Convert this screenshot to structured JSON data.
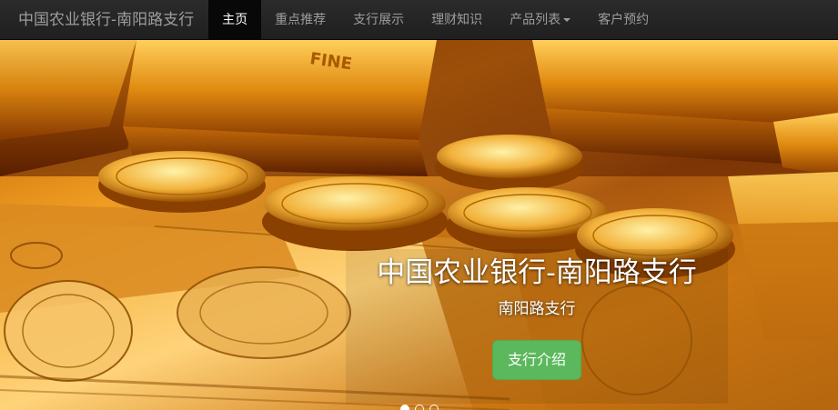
{
  "navbar": {
    "brand": "中国农业银行-南阳路支行",
    "items": [
      {
        "label": "主页",
        "active": true
      },
      {
        "label": "重点推荐",
        "active": false
      },
      {
        "label": "支行展示",
        "active": false
      },
      {
        "label": "理财知识",
        "active": false
      },
      {
        "label": "产品列表",
        "active": false,
        "dropdown": true
      },
      {
        "label": "客户预约",
        "active": false
      }
    ]
  },
  "carousel": {
    "heading": "中国农业银行-南阳路支行",
    "subheading": "南阳路支行",
    "button_label": "支行介绍",
    "ingot_stamp": "FINE",
    "indicators": [
      true,
      false,
      false
    ]
  },
  "colors": {
    "navbar_bg": "#222222",
    "cta_green": "#5cb85c"
  }
}
